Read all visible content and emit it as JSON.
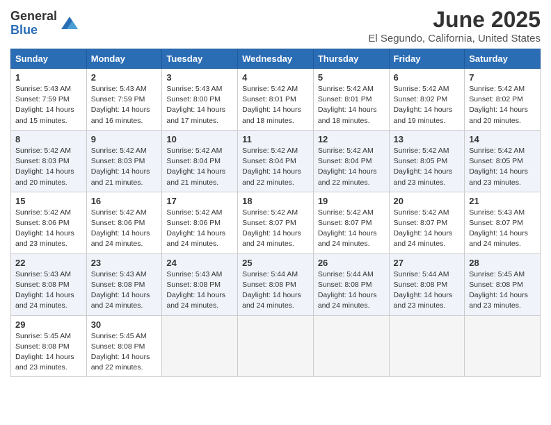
{
  "logo": {
    "general": "General",
    "blue": "Blue"
  },
  "title": "June 2025",
  "location": "El Segundo, California, United States",
  "weekdays": [
    "Sunday",
    "Monday",
    "Tuesday",
    "Wednesday",
    "Thursday",
    "Friday",
    "Saturday"
  ],
  "weeks": [
    [
      {
        "day": "1",
        "sunrise": "5:43 AM",
        "sunset": "7:59 PM",
        "daylight": "14 hours and 15 minutes."
      },
      {
        "day": "2",
        "sunrise": "5:43 AM",
        "sunset": "7:59 PM",
        "daylight": "14 hours and 16 minutes."
      },
      {
        "day": "3",
        "sunrise": "5:43 AM",
        "sunset": "8:00 PM",
        "daylight": "14 hours and 17 minutes."
      },
      {
        "day": "4",
        "sunrise": "5:42 AM",
        "sunset": "8:01 PM",
        "daylight": "14 hours and 18 minutes."
      },
      {
        "day": "5",
        "sunrise": "5:42 AM",
        "sunset": "8:01 PM",
        "daylight": "14 hours and 18 minutes."
      },
      {
        "day": "6",
        "sunrise": "5:42 AM",
        "sunset": "8:02 PM",
        "daylight": "14 hours and 19 minutes."
      },
      {
        "day": "7",
        "sunrise": "5:42 AM",
        "sunset": "8:02 PM",
        "daylight": "14 hours and 20 minutes."
      }
    ],
    [
      {
        "day": "8",
        "sunrise": "5:42 AM",
        "sunset": "8:03 PM",
        "daylight": "14 hours and 20 minutes."
      },
      {
        "day": "9",
        "sunrise": "5:42 AM",
        "sunset": "8:03 PM",
        "daylight": "14 hours and 21 minutes."
      },
      {
        "day": "10",
        "sunrise": "5:42 AM",
        "sunset": "8:04 PM",
        "daylight": "14 hours and 21 minutes."
      },
      {
        "day": "11",
        "sunrise": "5:42 AM",
        "sunset": "8:04 PM",
        "daylight": "14 hours and 22 minutes."
      },
      {
        "day": "12",
        "sunrise": "5:42 AM",
        "sunset": "8:04 PM",
        "daylight": "14 hours and 22 minutes."
      },
      {
        "day": "13",
        "sunrise": "5:42 AM",
        "sunset": "8:05 PM",
        "daylight": "14 hours and 23 minutes."
      },
      {
        "day": "14",
        "sunrise": "5:42 AM",
        "sunset": "8:05 PM",
        "daylight": "14 hours and 23 minutes."
      }
    ],
    [
      {
        "day": "15",
        "sunrise": "5:42 AM",
        "sunset": "8:06 PM",
        "daylight": "14 hours and 23 minutes."
      },
      {
        "day": "16",
        "sunrise": "5:42 AM",
        "sunset": "8:06 PM",
        "daylight": "14 hours and 24 minutes."
      },
      {
        "day": "17",
        "sunrise": "5:42 AM",
        "sunset": "8:06 PM",
        "daylight": "14 hours and 24 minutes."
      },
      {
        "day": "18",
        "sunrise": "5:42 AM",
        "sunset": "8:07 PM",
        "daylight": "14 hours and 24 minutes."
      },
      {
        "day": "19",
        "sunrise": "5:42 AM",
        "sunset": "8:07 PM",
        "daylight": "14 hours and 24 minutes."
      },
      {
        "day": "20",
        "sunrise": "5:42 AM",
        "sunset": "8:07 PM",
        "daylight": "14 hours and 24 minutes."
      },
      {
        "day": "21",
        "sunrise": "5:43 AM",
        "sunset": "8:07 PM",
        "daylight": "14 hours and 24 minutes."
      }
    ],
    [
      {
        "day": "22",
        "sunrise": "5:43 AM",
        "sunset": "8:08 PM",
        "daylight": "14 hours and 24 minutes."
      },
      {
        "day": "23",
        "sunrise": "5:43 AM",
        "sunset": "8:08 PM",
        "daylight": "14 hours and 24 minutes."
      },
      {
        "day": "24",
        "sunrise": "5:43 AM",
        "sunset": "8:08 PM",
        "daylight": "14 hours and 24 minutes."
      },
      {
        "day": "25",
        "sunrise": "5:44 AM",
        "sunset": "8:08 PM",
        "daylight": "14 hours and 24 minutes."
      },
      {
        "day": "26",
        "sunrise": "5:44 AM",
        "sunset": "8:08 PM",
        "daylight": "14 hours and 24 minutes."
      },
      {
        "day": "27",
        "sunrise": "5:44 AM",
        "sunset": "8:08 PM",
        "daylight": "14 hours and 23 minutes."
      },
      {
        "day": "28",
        "sunrise": "5:45 AM",
        "sunset": "8:08 PM",
        "daylight": "14 hours and 23 minutes."
      }
    ],
    [
      {
        "day": "29",
        "sunrise": "5:45 AM",
        "sunset": "8:08 PM",
        "daylight": "14 hours and 23 minutes."
      },
      {
        "day": "30",
        "sunrise": "5:45 AM",
        "sunset": "8:08 PM",
        "daylight": "14 hours and 22 minutes."
      },
      null,
      null,
      null,
      null,
      null
    ]
  ]
}
